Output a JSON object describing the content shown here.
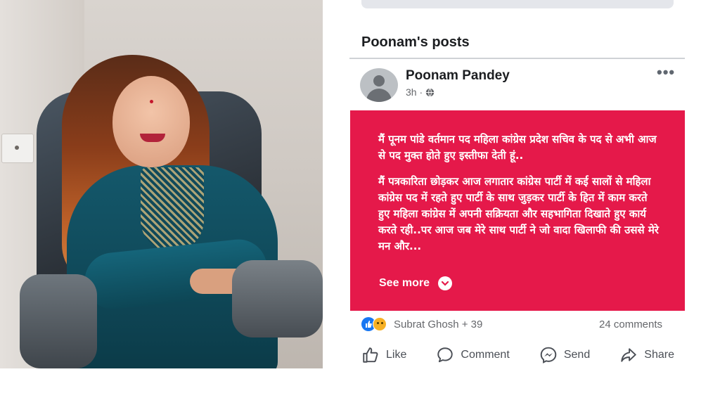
{
  "section": {
    "title": "Poonam's posts"
  },
  "post": {
    "author": "Poonam Pandey",
    "time": "3h ·",
    "paragraphs": [
      "मैं पूनम पांडे वर्तमान पद महिला कांग्रेस प्रदेश सचिव के पद से अभी आज से पद मुक्त होते हुए इस्तीफा देती हूं..",
      "मैं पत्रकारिता छोड़कर आज लगातार कांग्रेस पार्टी में कई सालों से महिला कांग्रेस पद में रहते हुए पार्टी के साथ जुड़कर पार्टी के हित में काम करते हुए महिला कांग्रेस में अपनी सक्रियता और सहभागिता दिखाते हुए कार्य करते रही..पर आज जब मेरे साथ पार्टी ने जो वादा खिलाफी की उससे मेरे मन और..."
    ],
    "see_more": "See more",
    "background_color": "#e5194a",
    "reactions": "Subrat Ghosh + 39",
    "comments": "24 comments"
  },
  "actions": {
    "like": "Like",
    "comment": "Comment",
    "send": "Send",
    "share": "Share"
  },
  "icons": [
    "globe-icon",
    "more-options-icon",
    "chevron-down-icon",
    "like-icon",
    "comment-icon",
    "messenger-icon",
    "share-icon"
  ]
}
